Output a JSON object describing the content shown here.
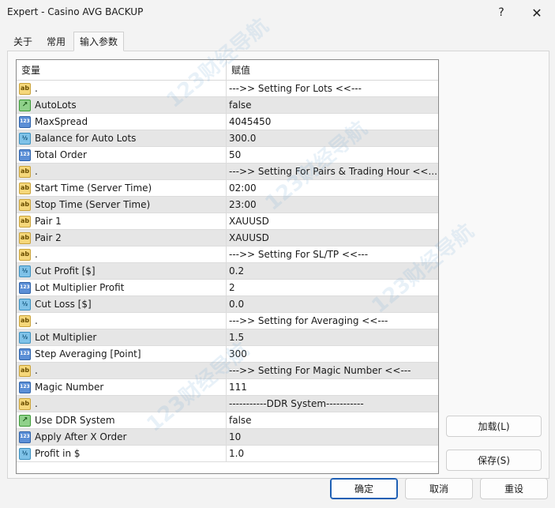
{
  "window": {
    "title": "Expert - Casino AVG BACKUP",
    "help_glyph": "?",
    "close_glyph": "✕"
  },
  "tabs": [
    {
      "label": "关于",
      "active": false
    },
    {
      "label": "常用",
      "active": false
    },
    {
      "label": "输入参数",
      "active": true
    }
  ],
  "table": {
    "headers": {
      "variable": "变量",
      "value": "赋值"
    },
    "rows": [
      {
        "icon": "ab",
        "name": ".",
        "value": "--->> Setting For Lots <<---"
      },
      {
        "icon": "bool",
        "name": "AutoLots",
        "value": "false"
      },
      {
        "icon": "num",
        "name": "MaxSpread",
        "value": "4045450"
      },
      {
        "icon": "frac",
        "name": "Balance for Auto Lots",
        "value": "300.0"
      },
      {
        "icon": "num",
        "name": "Total Order",
        "value": "50"
      },
      {
        "icon": "ab",
        "name": ".",
        "value": "--->> Setting For Pairs & Trading Hour <<..."
      },
      {
        "icon": "ab",
        "name": "Start Time (Server Time)",
        "value": "02:00"
      },
      {
        "icon": "ab",
        "name": "Stop Time (Server Time)",
        "value": "23:00"
      },
      {
        "icon": "ab",
        "name": "Pair 1",
        "value": "XAUUSD"
      },
      {
        "icon": "ab",
        "name": "Pair 2",
        "value": "XAUUSD"
      },
      {
        "icon": "ab",
        "name": ".",
        "value": "--->> Setting For SL/TP <<---"
      },
      {
        "icon": "frac",
        "name": "Cut Profit [$]",
        "value": "0.2"
      },
      {
        "icon": "num",
        "name": "Lot Multiplier Profit",
        "value": "2"
      },
      {
        "icon": "frac",
        "name": "Cut Loss [$]",
        "value": "0.0"
      },
      {
        "icon": "ab",
        "name": ".",
        "value": "--->> Setting for Averaging  <<---"
      },
      {
        "icon": "frac",
        "name": "Lot Multiplier",
        "value": "1.5"
      },
      {
        "icon": "num",
        "name": "Step Averaging [Point]",
        "value": "300"
      },
      {
        "icon": "ab",
        "name": ".",
        "value": "--->> Setting For Magic Number <<---"
      },
      {
        "icon": "num",
        "name": "Magic Number",
        "value": "111"
      },
      {
        "icon": "ab",
        "name": ".",
        "value": "-----------DDR System-----------"
      },
      {
        "icon": "bool",
        "name": "Use DDR System",
        "value": "false"
      },
      {
        "icon": "num",
        "name": "Apply After X Order",
        "value": "10"
      },
      {
        "icon": "frac",
        "name": "Profit in $",
        "value": "1.0"
      }
    ]
  },
  "icon_glyphs": {
    "ab": "ab",
    "num": "123",
    "frac": "½",
    "bool": "↗"
  },
  "icon_names": {
    "ab": "string-type-icon",
    "num": "integer-type-icon",
    "frac": "double-type-icon",
    "bool": "bool-type-icon"
  },
  "buttons": {
    "load": "加载(L)",
    "save": "保存(S)",
    "ok": "确定",
    "cancel": "取消",
    "reset": "重设"
  },
  "watermark": "123财经导航"
}
